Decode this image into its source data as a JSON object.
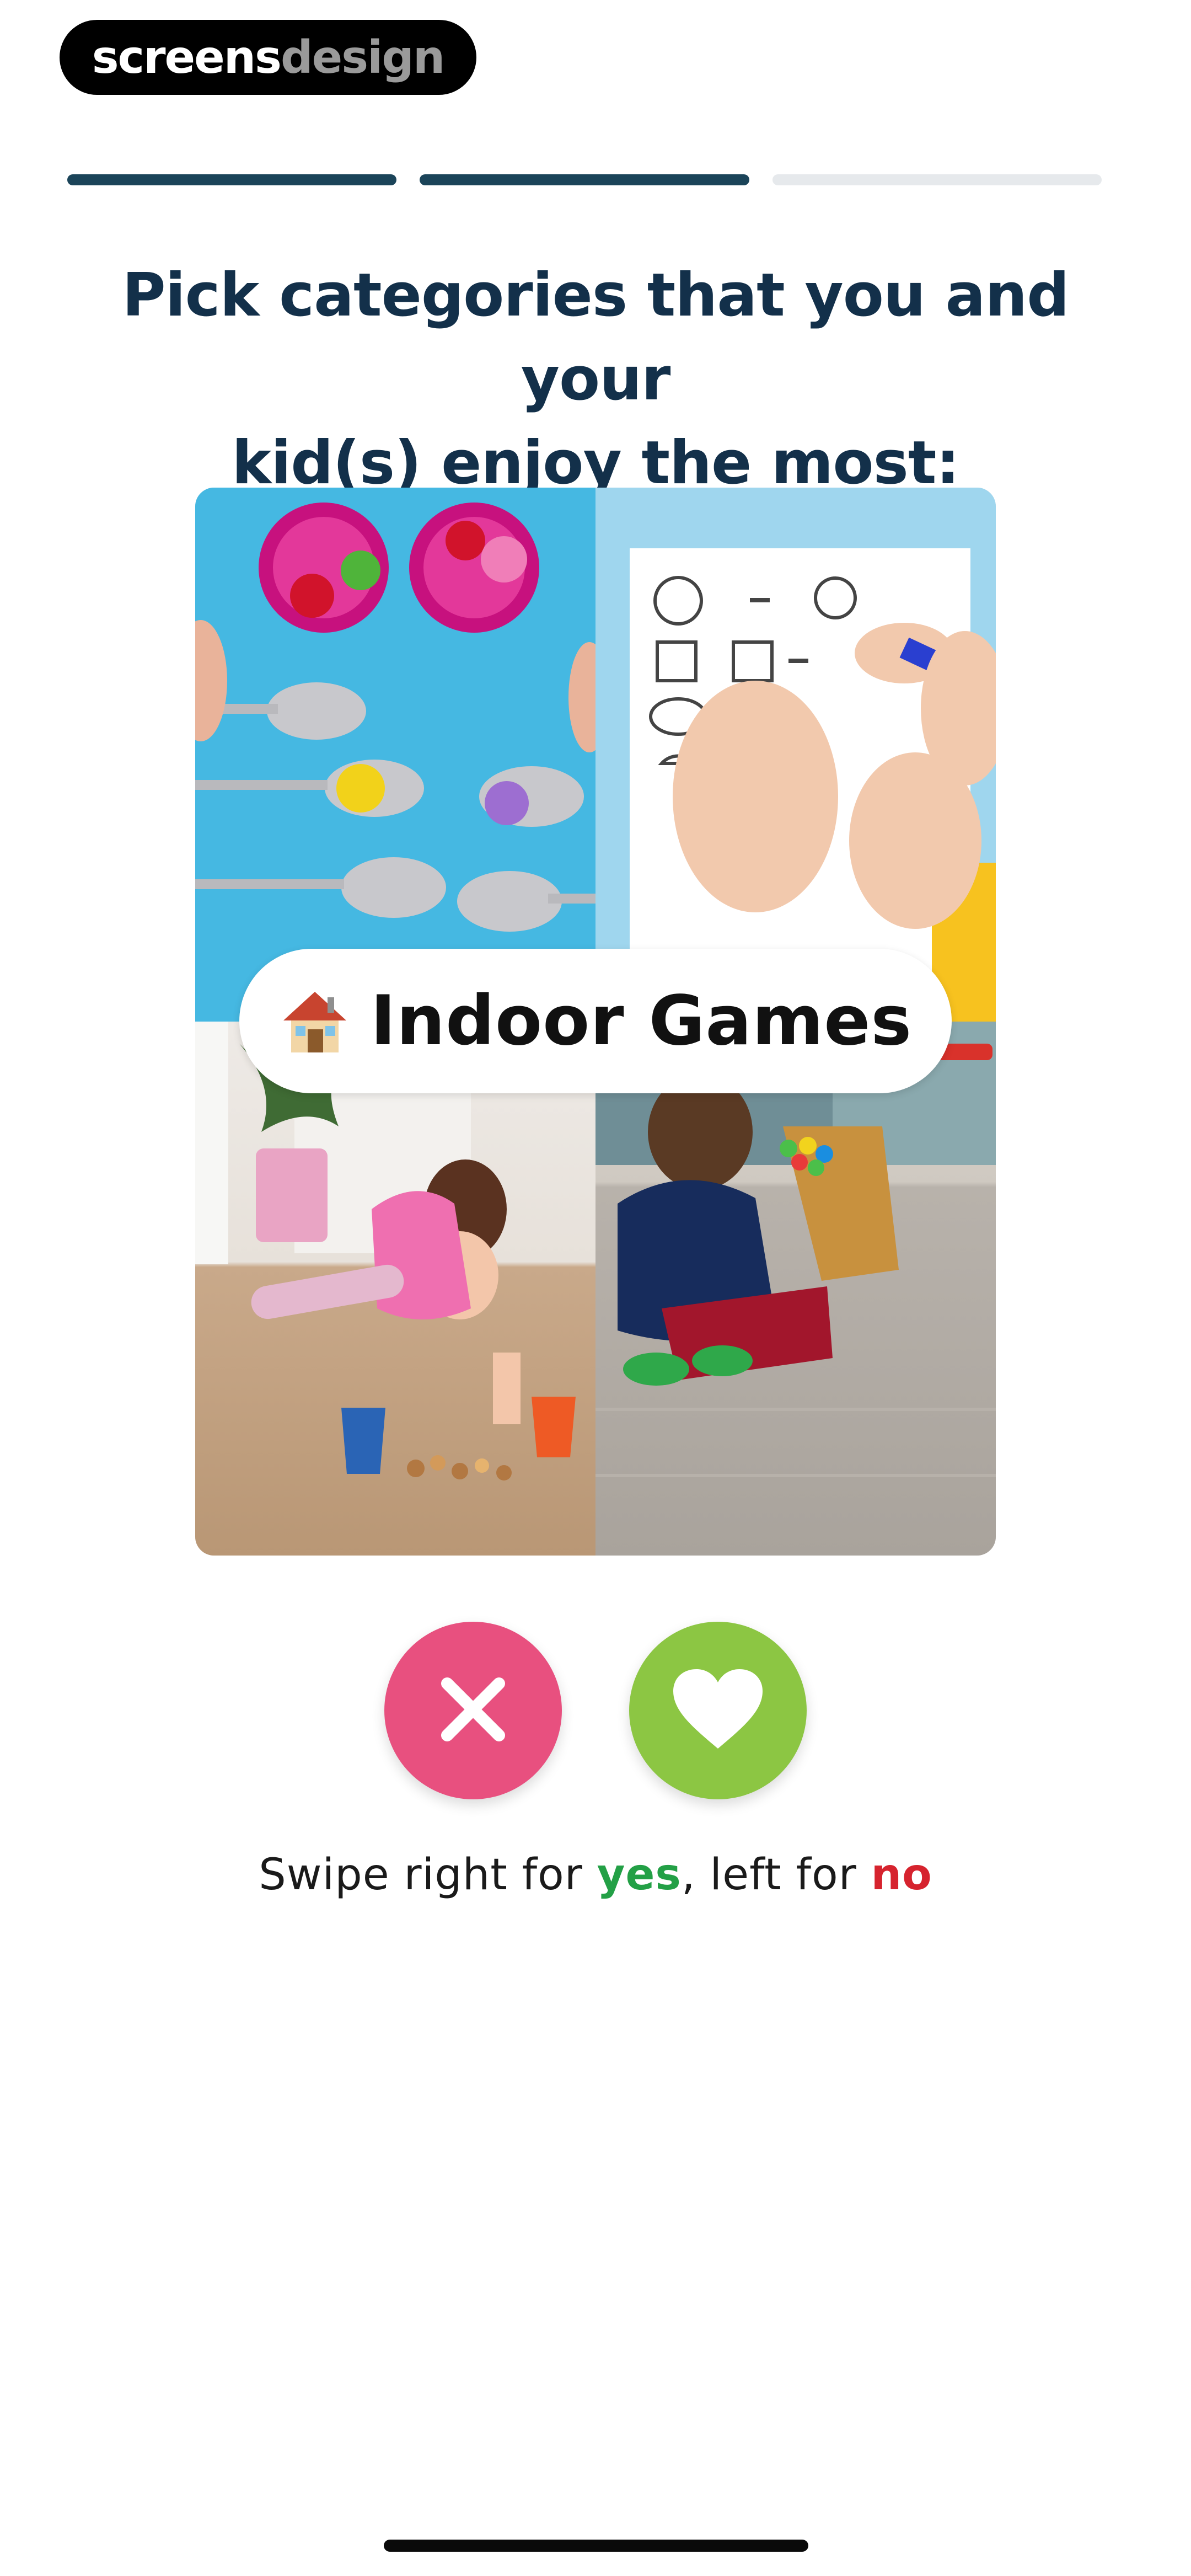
{
  "watermark": {
    "part1": "screens",
    "part2": "design"
  },
  "progress": {
    "total_steps": 3,
    "completed_steps": 2
  },
  "title": {
    "line1": "Pick categories that you and your",
    "line2": "kid(s) enjoy the most:"
  },
  "card": {
    "category_icon": "house-icon",
    "category_label": "Indoor Games"
  },
  "actions": {
    "no_button_icon": "close-icon",
    "yes_button_icon": "heart-icon",
    "no_color": "#e8507f",
    "yes_color": "#8cc643"
  },
  "hint": {
    "prefix": "Swipe right for ",
    "yes": "yes",
    "middle": ", left for ",
    "no": "no",
    "yes_color": "#23a046",
    "no_color": "#d6232e"
  }
}
